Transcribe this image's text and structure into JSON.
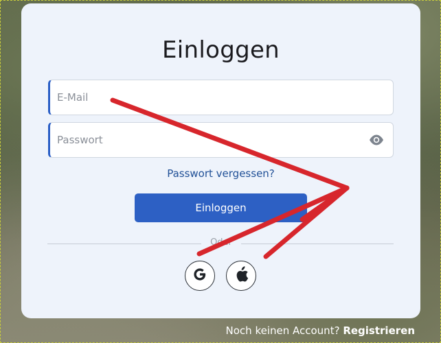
{
  "login": {
    "title": "Einloggen",
    "email_placeholder": "E-Mail",
    "password_placeholder": "Passwort",
    "forgot_label": "Passwort vergessen?",
    "submit_label": "Einloggen",
    "divider_label": "Oder"
  },
  "social": {
    "google_icon": "google-icon",
    "apple_icon": "apple-icon"
  },
  "footer": {
    "question": "Noch keinen Account?",
    "register_label": "Registrieren"
  },
  "colors": {
    "accent": "#2d60c4",
    "link": "#1f4f96",
    "card_background": "#eef3fb",
    "annotation": "#d7262c"
  }
}
